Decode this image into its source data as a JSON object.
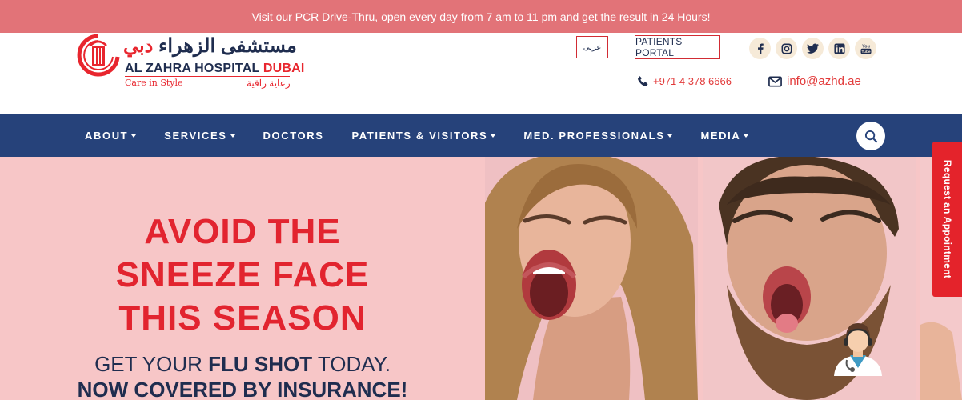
{
  "topbar": {
    "message": "Visit our PCR Drive-Thru, open every day from 7 am to 11 pm and get the result in 24 Hours!"
  },
  "logo": {
    "arabic_name_main": "مستشفى الزهراء",
    "arabic_name_city": "دبي",
    "english_name_main": "AL ZAHRA HOSPITAL",
    "english_name_city": "DUBAI",
    "tagline": "Care in Style",
    "tagline_arabic": "رعاية راقية"
  },
  "header": {
    "language_button": "عربى",
    "patients_portal": "PATIENTS PORTAL",
    "phone": "+971 4 378 6666",
    "email": "info@azhd.ae",
    "social_icons": [
      "facebook-icon",
      "instagram-icon",
      "twitter-icon",
      "linkedin-icon",
      "youtube-icon"
    ]
  },
  "nav": {
    "items": [
      {
        "label": "ABOUT",
        "dropdown": true
      },
      {
        "label": "SERVICES",
        "dropdown": true
      },
      {
        "label": "DOCTORS",
        "dropdown": false
      },
      {
        "label": "PATIENTS & VISITORS",
        "dropdown": true
      },
      {
        "label": "MED. PROFESSIONALS",
        "dropdown": true
      },
      {
        "label": "MEDIA",
        "dropdown": true
      }
    ]
  },
  "hero": {
    "headline_1": "AVOID THE",
    "headline_2": "SNEEZE FACE",
    "headline_3": "THIS SEASON",
    "sub_line_1_start": "GET YOUR ",
    "sub_line_1_bold": "FLU SHOT",
    "sub_line_1_end": " TODAY.",
    "sub_line_2": "NOW COVERED BY INSURANCE!"
  },
  "side_tab": {
    "label": "Request an Appointment"
  },
  "colors": {
    "topbar": "#e27378",
    "navy": "#26427a",
    "brand_red": "#e4232b",
    "hero_pink": "#f7c6c7"
  }
}
